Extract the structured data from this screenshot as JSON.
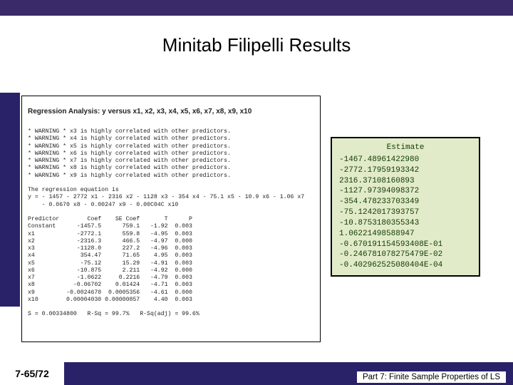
{
  "title": "Minitab Filipelli Results",
  "footer": {
    "page": "7-65/72",
    "caption": "Part 7: Finite Sample Properties of LS"
  },
  "regression": {
    "header": "Regression Analysis: y versus x1, x2, x3, x4, x5, x6, x7, x8, x9, x10",
    "warnings": [
      "* WARNING * x3 is highly correlated with other predictors.",
      "* WARNING * x4 is highly correlated with other predictors.",
      "* WARNING * x5 is highly correlated with other predictors.",
      "* WARNING * x6 is highly correlated with other predictors.",
      "* WARNING * x7 is highly correlated with other predictors.",
      "* WARNING * x8 is highly correlated with other predictors.",
      "* WARNING * x9 is highly correlated with other predictors."
    ],
    "equation_intro": "The regression equation is",
    "equation": "y = - 1457 - 2772 x1 - 2316 x2 - 1128 x3 - 354 x4 - 75.1 x5 - 10.9 x6 - 1.06 x7\n    - 0.0670 x8 - 0.00247 x9 - 0.00C04C x10",
    "table_header": "Predictor        Coef    SE Coef       T      P",
    "rows": [
      "Constant      -1457.5      759.1   -1.92  0.003",
      "x1            -2772.1      559.8   -4.95  0.003",
      "x2            -2316.3      466.5   -4.97  0.000",
      "x3            -1128.0      227.2   -4.96  0.003",
      "x4             354.47      71.65    4.95  0.003",
      "x5             -75.12      15.29   -4.91  0.003",
      "x6            -10.875      2.211   -4.92  0.000",
      "x7            -1.0622     0.2216   -4.79  0.003",
      "x8           -0.06702    0.01424   -4.71  0.003",
      "x9         -0.0024670  0.0005356   -4.61  0.000",
      "x10        0.00004030 0.00000857    4.40  0.003"
    ],
    "summary": "S = 0.00334800   R-Sq = 99.7%   R-Sq(adj) = 99.6%"
  },
  "estimate": {
    "header": "Estimate",
    "values": [
      "-1467.48961422980",
      "-2772.17959193342",
      " 2316.37108160893",
      "-1127.97394098372",
      "-354.478233703349",
      "-75.1242017393757",
      "-10.8753180355343",
      " 1.06221498588947",
      "-0.670191154593408E-01",
      "-0.246781078275479E-02",
      "-0.402962525080404E-04"
    ]
  }
}
